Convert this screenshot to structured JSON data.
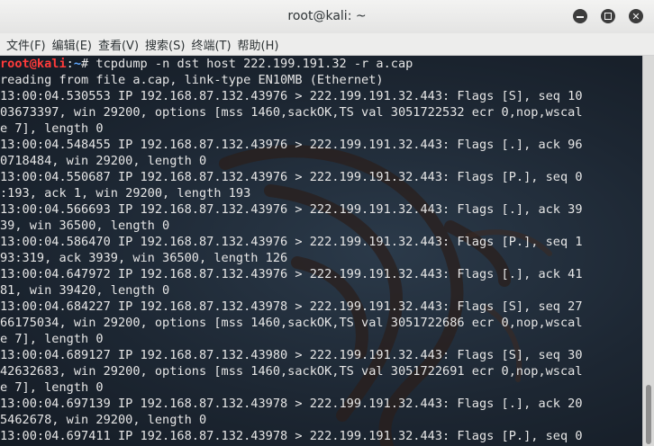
{
  "window": {
    "title": "root@kali: ~"
  },
  "menu": [
    "文件(F)",
    "编辑(E)",
    "查看(V)",
    "搜索(S)",
    "终端(T)",
    "帮助(H)"
  ],
  "terminal": {
    "prompt": {
      "user": "root@kali",
      "sep": ":",
      "path": "~",
      "symbol": "# "
    },
    "command": "tcpdump -n dst host 222.199.191.32 -r a.cap",
    "lines": [
      "reading from file a.cap, link-type EN10MB (Ethernet)",
      "13:00:04.530553 IP 192.168.87.132.43976 > 222.199.191.32.443: Flags [S], seq 10",
      "03673397, win 29200, options [mss 1460,sackOK,TS val 3051722532 ecr 0,nop,wscal",
      "e 7], length 0",
      "13:00:04.548455 IP 192.168.87.132.43976 > 222.199.191.32.443: Flags [.], ack 96",
      "0718484, win 29200, length 0",
      "13:00:04.550687 IP 192.168.87.132.43976 > 222.199.191.32.443: Flags [P.], seq 0",
      ":193, ack 1, win 29200, length 193",
      "13:00:04.566693 IP 192.168.87.132.43976 > 222.199.191.32.443: Flags [.], ack 39",
      "39, win 36500, length 0",
      "13:00:04.586470 IP 192.168.87.132.43976 > 222.199.191.32.443: Flags [P.], seq 1",
      "93:319, ack 3939, win 36500, length 126",
      "13:00:04.647972 IP 192.168.87.132.43976 > 222.199.191.32.443: Flags [.], ack 41",
      "81, win 39420, length 0",
      "13:00:04.684227 IP 192.168.87.132.43978 > 222.199.191.32.443: Flags [S], seq 27",
      "66175034, win 29200, options [mss 1460,sackOK,TS val 3051722686 ecr 0,nop,wscal",
      "e 7], length 0",
      "13:00:04.689127 IP 192.168.87.132.43980 > 222.199.191.32.443: Flags [S], seq 30",
      "42632683, win 29200, options [mss 1460,sackOK,TS val 3051722691 ecr 0,nop,wscal",
      "e 7], length 0",
      "13:00:04.697139 IP 192.168.87.132.43978 > 222.199.191.32.443: Flags [.], ack 20",
      "5462678, win 29200, length 0",
      "13:00:04.697411 IP 192.168.87.132.43978 > 222.199.191.32.443: Flags [P.], seq 0"
    ]
  },
  "icons": {
    "minimize": "minimize-icon",
    "maximize": "maximize-icon",
    "close": "close-icon"
  },
  "colors": {
    "prompt_user": "#ff3b3b",
    "prompt_path": "#5fa8ff",
    "terminal_bg": "#1d2733",
    "terminal_fg": "#e6e6e6"
  }
}
